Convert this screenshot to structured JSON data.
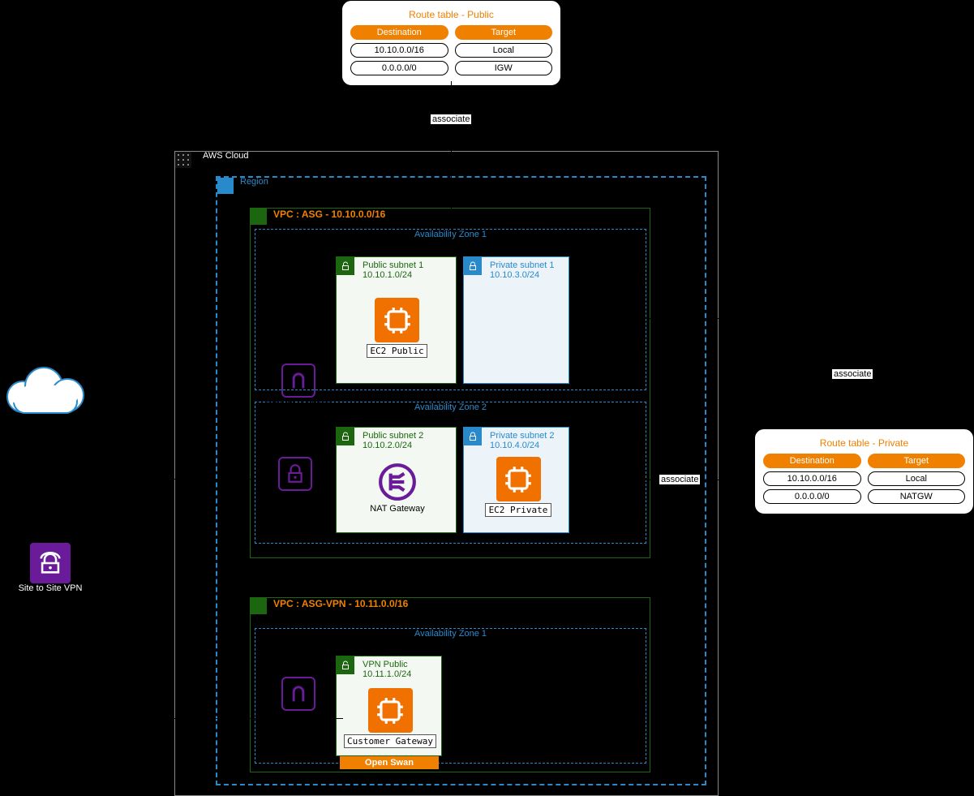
{
  "route_public": {
    "title": "Route table - Public",
    "head_dest": "Destination",
    "head_tgt": "Target",
    "rows": [
      {
        "dest": "10.10.0.0/16",
        "tgt": "Local"
      },
      {
        "dest": "0.0.0.0/0",
        "tgt": "IGW"
      }
    ]
  },
  "route_private": {
    "title": "Route table - Private",
    "head_dest": "Destination",
    "head_tgt": "Target",
    "rows": [
      {
        "dest": "10.10.0.0/16",
        "tgt": "Local"
      },
      {
        "dest": "0.0.0.0/0",
        "tgt": "NATGW"
      }
    ]
  },
  "cloud": {
    "label": "AWS Cloud"
  },
  "region": {
    "label": "Region"
  },
  "vpc1": {
    "label": "VPC : ASG - 10.10.0.0/16"
  },
  "vpc2": {
    "label": "VPC : ASG-VPN - 10.11.0.0/16"
  },
  "az": {
    "az1": "Availability Zone 1",
    "az2": "Availability Zone 2",
    "az1b": "Availability Zone 1"
  },
  "subnets": {
    "pub1": {
      "name": "Public subnet 1",
      "cidr": "10.10.1.0/24"
    },
    "prv1": {
      "name": "Private subnet 1",
      "cidr": "10.10.3.0/24"
    },
    "pub2": {
      "name": "Public subnet 2",
      "cidr": "10.10.2.0/24"
    },
    "prv2": {
      "name": "Private subnet 2",
      "cidr": "10.10.4.0/24"
    },
    "vpnpub": {
      "name": "VPN Public",
      "cidr": "10.11.1.0/24"
    }
  },
  "nodes": {
    "igw1": "Internet Gateway",
    "vpngw": "VPN Gateway",
    "ec2pub": "EC2 Public",
    "nat": "NAT Gateway",
    "ec2prv": "EC2 Private",
    "igw2": "Internet Gateway",
    "cgw": "Customer Gateway",
    "openswan": "Open Swan",
    "s2s": "Site to Site VPN"
  },
  "edges": {
    "assoc": "associate"
  }
}
